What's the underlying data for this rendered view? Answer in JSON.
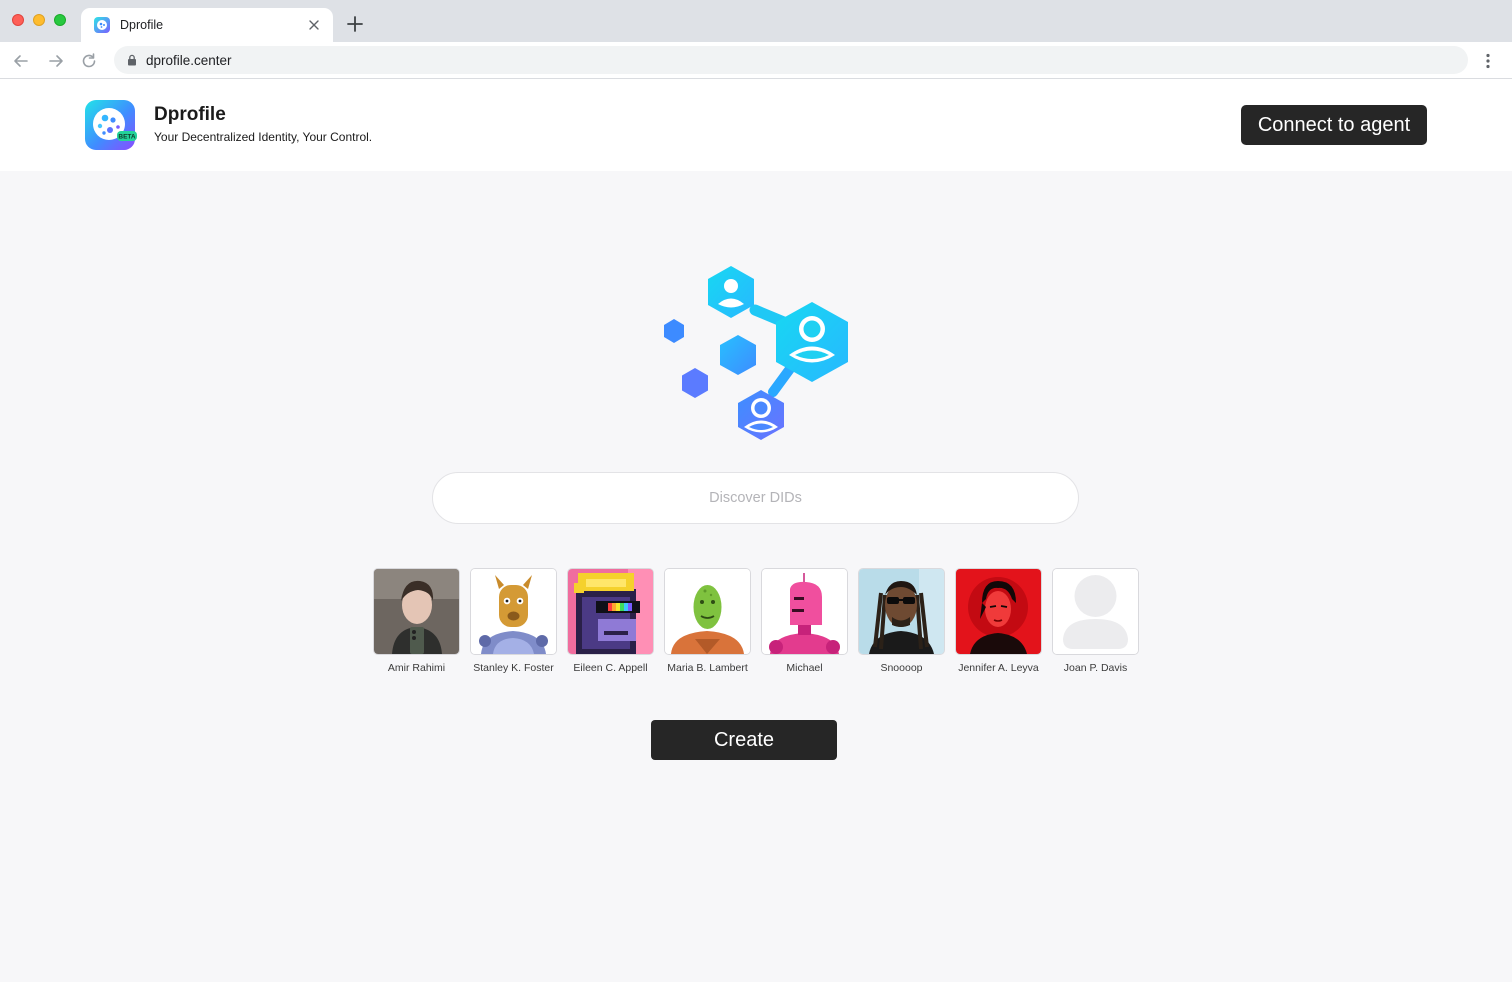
{
  "browser": {
    "tab_title": "Dprofile",
    "url": "dprofile.center"
  },
  "header": {
    "brand_name": "Dprofile",
    "tagline": "Your Decentralized Identity, Your Control.",
    "logo_badge": "BETA",
    "connect_label": "Connect to agent"
  },
  "search": {
    "placeholder": "Discover DIDs",
    "value": ""
  },
  "profiles": [
    {
      "name": "Amir Rahimi",
      "avatar": "photo-portrait"
    },
    {
      "name": "Stanley K. Foster",
      "avatar": "horned-robot"
    },
    {
      "name": "Eileen C. Appell",
      "avatar": "pixel-ape"
    },
    {
      "name": "Maria B. Lambert",
      "avatar": "green-alien"
    },
    {
      "name": "Michael",
      "avatar": "pink-robot"
    },
    {
      "name": "Snoooop",
      "avatar": "photo-portrait-sunglasses"
    },
    {
      "name": "Jennifer A. Leyva",
      "avatar": "red-illustration"
    },
    {
      "name": "Joan P. Davis",
      "avatar": "default-user-silhouette"
    }
  ],
  "create_label": "Create",
  "colors": {
    "accent_dark": "#262626",
    "hero_cyan": "#1fd6f0",
    "hero_blue": "#3b8cff",
    "page_bg": "#f7f7f9"
  }
}
